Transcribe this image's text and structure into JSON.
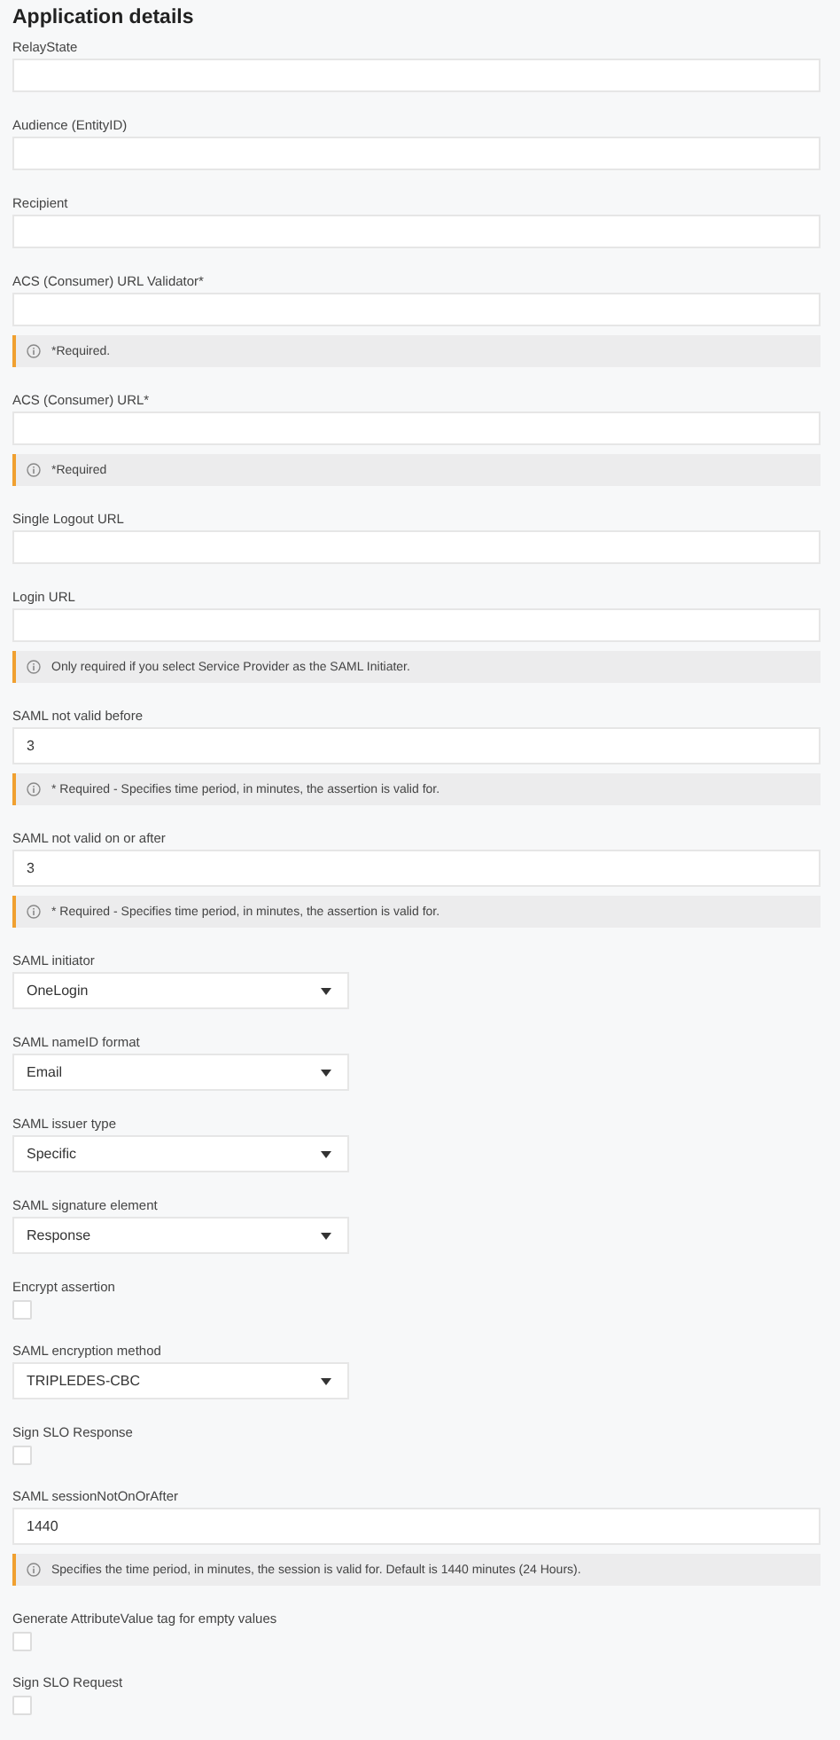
{
  "title": "Application details",
  "fields": [
    {
      "kind": "text",
      "label": "RelayState"
    },
    {
      "kind": "text",
      "label": "Audience (EntityID)"
    },
    {
      "kind": "text",
      "label": "Recipient"
    },
    {
      "kind": "text",
      "label": "ACS (Consumer) URL Validator*",
      "hint": "*Required."
    },
    {
      "kind": "text",
      "label": "ACS (Consumer) URL*",
      "hint": "*Required"
    },
    {
      "kind": "text",
      "label": "Single Logout URL"
    },
    {
      "kind": "text",
      "label": "Login URL",
      "hint": "Only required if you select Service Provider as the SAML Initiater."
    },
    {
      "kind": "text",
      "label": "SAML not valid before",
      "value": "3",
      "hint": "* Required - Specifies time period, in minutes, the assertion is valid for."
    },
    {
      "kind": "text",
      "label": "SAML not valid on or after",
      "value": "3",
      "hint": "* Required - Specifies time period, in minutes, the assertion is valid for."
    },
    {
      "kind": "select",
      "label": "SAML initiator",
      "value": "OneLogin"
    },
    {
      "kind": "select",
      "label": "SAML nameID format",
      "value": "Email"
    },
    {
      "kind": "select",
      "label": "SAML issuer type",
      "value": "Specific"
    },
    {
      "kind": "select",
      "label": "SAML signature element",
      "value": "Response"
    },
    {
      "kind": "checkbox",
      "label": "Encrypt assertion",
      "checked": false
    },
    {
      "kind": "select",
      "label": "SAML encryption method",
      "value": "TRIPLEDES-CBC"
    },
    {
      "kind": "checkbox",
      "label": "Sign SLO Response",
      "checked": false
    },
    {
      "kind": "text",
      "label": "SAML sessionNotOnOrAfter",
      "value": "1440",
      "hint": "Specifies the time period, in minutes, the session is valid for. Default is 1440 minutes (24 Hours)."
    },
    {
      "kind": "checkbox",
      "label": "Generate AttributeValue tag for empty values",
      "checked": false
    },
    {
      "kind": "checkbox",
      "label": "Sign SLO Request",
      "checked": false
    }
  ]
}
